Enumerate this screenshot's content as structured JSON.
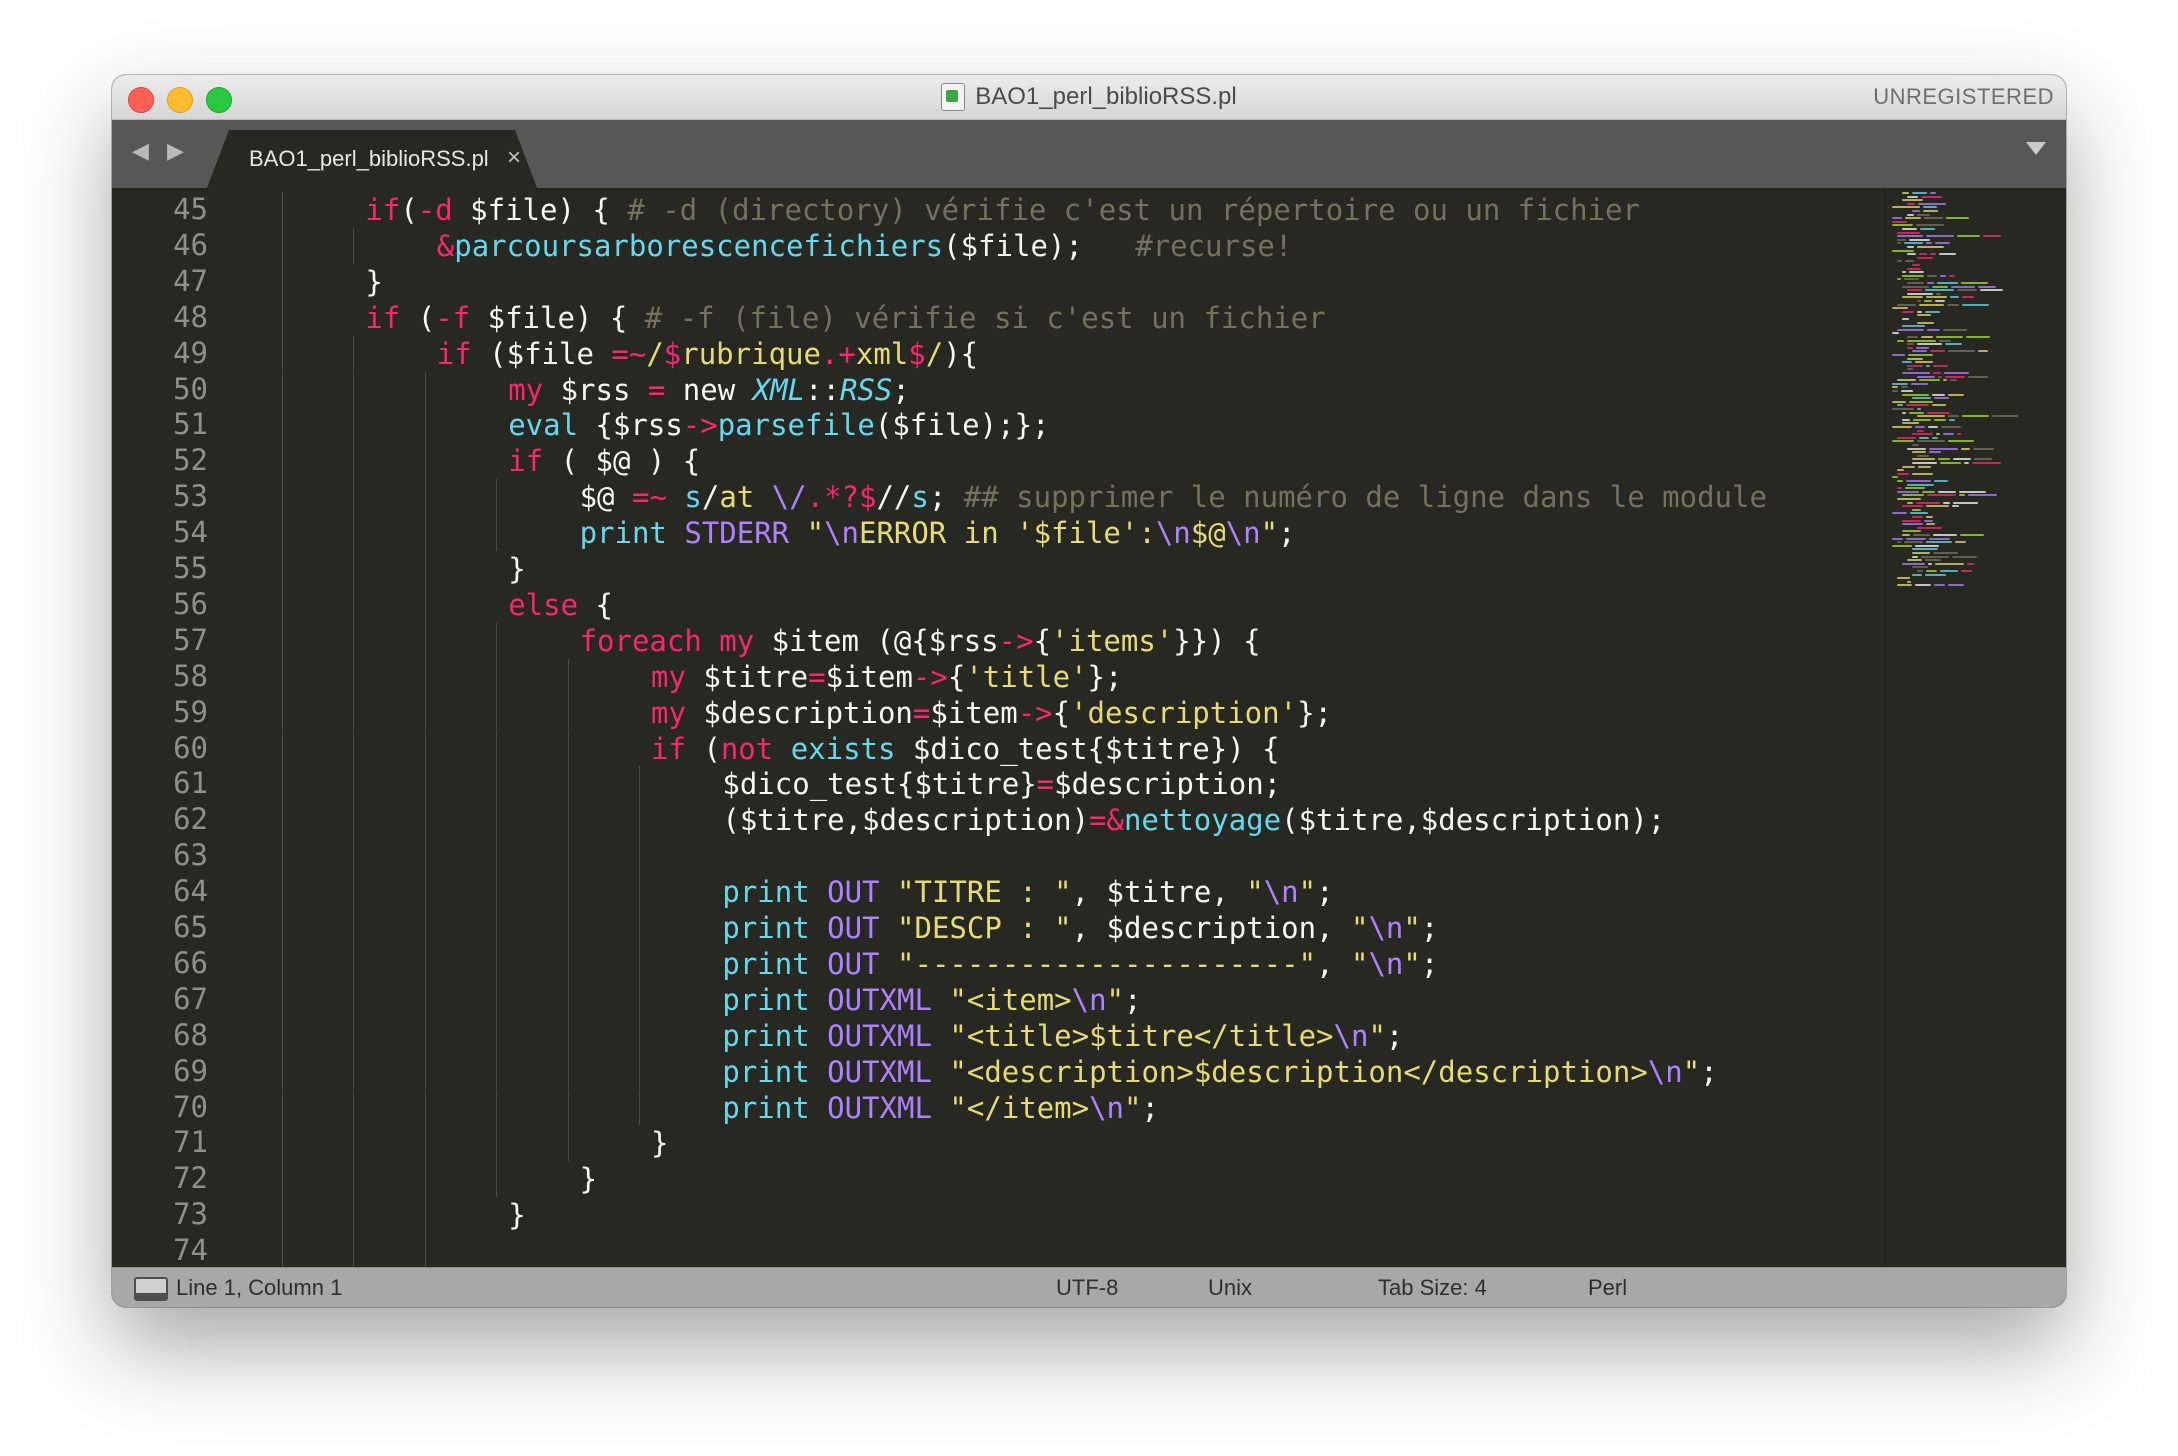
{
  "window": {
    "title": "BAO1_perl_biblioRSS.pl",
    "registration": "UNREGISTERED"
  },
  "tab": {
    "label": "BAO1_perl_biblioRSS.pl",
    "close": "×"
  },
  "nav": {
    "arrows": "◀ ▶"
  },
  "status": {
    "position": "Line 1, Column 1",
    "encoding": "UTF-8",
    "line_endings": "Unix",
    "tab_size": "Tab Size: 4",
    "syntax": "Perl"
  },
  "colors": {
    "keyword": "#f92672",
    "string": "#e6db74",
    "comment": "#75715e",
    "function": "#66d9ef",
    "constant": "#ae81ff",
    "entity": "#a6e22e",
    "background": "#272822",
    "foreground": "#f8f8f2"
  },
  "editor": {
    "lines": [
      {
        "num": "45",
        "indent": 2,
        "tokens": [
          [
            "k",
            "if"
          ],
          [
            "",
            "("
          ],
          [
            "o",
            "-d"
          ],
          [
            "",
            " $file) { "
          ],
          [
            "c",
            "# -d (directory) vérifie c'est un répertoire ou un fichier"
          ]
        ]
      },
      {
        "num": "46",
        "indent": 3,
        "tokens": [
          [
            "o",
            "&"
          ],
          [
            "f",
            "parcoursarborescencefichiers"
          ],
          [
            "",
            "($file);   "
          ],
          [
            "c",
            "#recurse!"
          ]
        ]
      },
      {
        "num": "47",
        "indent": 2,
        "tokens": [
          [
            "",
            "}"
          ]
        ]
      },
      {
        "num": "48",
        "indent": 2,
        "tokens": [
          [
            "k",
            "if"
          ],
          [
            "",
            " ("
          ],
          [
            "o",
            "-f"
          ],
          [
            "",
            " $file) { "
          ],
          [
            "c",
            "# -f (file) vérifie si c'est un fichier"
          ]
        ]
      },
      {
        "num": "49",
        "indent": 3,
        "tokens": [
          [
            "k",
            "if"
          ],
          [
            "",
            " ($file "
          ],
          [
            "o",
            "=~"
          ],
          [
            "s",
            "/"
          ],
          [
            "o",
            "$"
          ],
          [
            "s",
            "rubrique"
          ],
          [
            "o",
            ".+"
          ],
          [
            "s",
            "xml"
          ],
          [
            "o",
            "$"
          ],
          [
            "s",
            "/"
          ],
          [
            "",
            "){"
          ]
        ]
      },
      {
        "num": "50",
        "indent": 4,
        "tokens": [
          [
            "k",
            "my"
          ],
          [
            "",
            " $rss "
          ],
          [
            "o",
            "="
          ],
          [
            "",
            " new "
          ],
          [
            "i",
            "XML"
          ],
          [
            "",
            "::"
          ],
          [
            "i",
            "RSS"
          ],
          [
            "",
            ";"
          ]
        ]
      },
      {
        "num": "51",
        "indent": 4,
        "tokens": [
          [
            "f",
            "eval"
          ],
          [
            "",
            " {$rss"
          ],
          [
            "o",
            "->"
          ],
          [
            "f",
            "parsefile"
          ],
          [
            "",
            "($file);};"
          ]
        ]
      },
      {
        "num": "52",
        "indent": 4,
        "tokens": [
          [
            "k",
            "if"
          ],
          [
            "",
            " ( $@ ) {"
          ]
        ]
      },
      {
        "num": "53",
        "indent": 5,
        "tokens": [
          [
            "",
            "$@ "
          ],
          [
            "o",
            "=~"
          ],
          [
            "",
            " "
          ],
          [
            "f",
            "s"
          ],
          [
            "",
            "/"
          ],
          [
            "s",
            "at "
          ],
          [
            "n",
            "\\/"
          ],
          [
            "o",
            ".*?$"
          ],
          [
            "",
            "//"
          ],
          [
            "f",
            "s"
          ],
          [
            "",
            ";"
          ],
          [
            "",
            " "
          ],
          [
            "c",
            "## supprimer le numéro de ligne dans le module"
          ]
        ]
      },
      {
        "num": "54",
        "indent": 5,
        "tokens": [
          [
            "f",
            "print"
          ],
          [
            "",
            " "
          ],
          [
            "n",
            "STDERR"
          ],
          [
            "",
            " "
          ],
          [
            "s",
            "\""
          ],
          [
            "n",
            "\\n"
          ],
          [
            "s",
            "ERROR in '$file':"
          ],
          [
            "n",
            "\\n"
          ],
          [
            "s",
            "$@"
          ],
          [
            "n",
            "\\n"
          ],
          [
            "s",
            "\""
          ],
          [
            "",
            ";"
          ]
        ]
      },
      {
        "num": "55",
        "indent": 4,
        "tokens": [
          [
            "",
            "}"
          ]
        ]
      },
      {
        "num": "56",
        "indent": 4,
        "tokens": [
          [
            "k",
            "else"
          ],
          [
            "",
            " {"
          ]
        ]
      },
      {
        "num": "57",
        "indent": 5,
        "tokens": [
          [
            "k",
            "foreach"
          ],
          [
            "",
            " "
          ],
          [
            "k",
            "my"
          ],
          [
            "",
            " $item (@{$rss"
          ],
          [
            "o",
            "->"
          ],
          [
            "",
            "{"
          ],
          [
            "s",
            "'items'"
          ],
          [
            "",
            "}}) {"
          ]
        ]
      },
      {
        "num": "58",
        "indent": 6,
        "tokens": [
          [
            "k",
            "my"
          ],
          [
            "",
            " $titre"
          ],
          [
            "o",
            "="
          ],
          [
            "",
            "$item"
          ],
          [
            "o",
            "->"
          ],
          [
            "",
            "{"
          ],
          [
            "s",
            "'title'"
          ],
          [
            "",
            "};"
          ]
        ]
      },
      {
        "num": "59",
        "indent": 6,
        "tokens": [
          [
            "k",
            "my"
          ],
          [
            "",
            " $description"
          ],
          [
            "o",
            "="
          ],
          [
            "",
            "$item"
          ],
          [
            "o",
            "->"
          ],
          [
            "",
            "{"
          ],
          [
            "s",
            "'description'"
          ],
          [
            "",
            "};"
          ]
        ]
      },
      {
        "num": "60",
        "indent": 6,
        "tokens": [
          [
            "k",
            "if"
          ],
          [
            "",
            " ("
          ],
          [
            "k",
            "not"
          ],
          [
            "",
            " "
          ],
          [
            "f",
            "exists"
          ],
          [
            "",
            " $dico_test{$titre}) {"
          ]
        ]
      },
      {
        "num": "61",
        "indent": 7,
        "tokens": [
          [
            "",
            "$dico_test{$titre}"
          ],
          [
            "o",
            "="
          ],
          [
            "",
            "$description;"
          ]
        ]
      },
      {
        "num": "62",
        "indent": 7,
        "tokens": [
          [
            "",
            "($titre,$description)"
          ],
          [
            "o",
            "=&"
          ],
          [
            "f",
            "nettoyage"
          ],
          [
            "",
            "($titre,$description);"
          ]
        ]
      },
      {
        "num": "63",
        "indent": 7,
        "tokens": []
      },
      {
        "num": "64",
        "indent": 7,
        "tokens": [
          [
            "f",
            "print"
          ],
          [
            "",
            " "
          ],
          [
            "n",
            "OUT"
          ],
          [
            "",
            " "
          ],
          [
            "s",
            "\"TITRE : \""
          ],
          [
            "",
            ", $titre, "
          ],
          [
            "s",
            "\""
          ],
          [
            "n",
            "\\n"
          ],
          [
            "s",
            "\""
          ],
          [
            "",
            ";"
          ]
        ]
      },
      {
        "num": "65",
        "indent": 7,
        "tokens": [
          [
            "f",
            "print"
          ],
          [
            "",
            " "
          ],
          [
            "n",
            "OUT"
          ],
          [
            "",
            " "
          ],
          [
            "s",
            "\"DESCP : \""
          ],
          [
            "",
            ", $description, "
          ],
          [
            "s",
            "\""
          ],
          [
            "n",
            "\\n"
          ],
          [
            "s",
            "\""
          ],
          [
            "",
            ";"
          ]
        ]
      },
      {
        "num": "66",
        "indent": 7,
        "tokens": [
          [
            "f",
            "print"
          ],
          [
            "",
            " "
          ],
          [
            "n",
            "OUT"
          ],
          [
            "",
            " "
          ],
          [
            "s",
            "\"----------------------\""
          ],
          [
            "",
            ", "
          ],
          [
            "s",
            "\""
          ],
          [
            "n",
            "\\n"
          ],
          [
            "s",
            "\""
          ],
          [
            "",
            ";"
          ]
        ]
      },
      {
        "num": "67",
        "indent": 7,
        "tokens": [
          [
            "f",
            "print"
          ],
          [
            "",
            " "
          ],
          [
            "n",
            "OUTXML"
          ],
          [
            "",
            " "
          ],
          [
            "s",
            "\"<item>"
          ],
          [
            "n",
            "\\n"
          ],
          [
            "s",
            "\""
          ],
          [
            "",
            ";"
          ]
        ]
      },
      {
        "num": "68",
        "indent": 7,
        "tokens": [
          [
            "f",
            "print"
          ],
          [
            "",
            " "
          ],
          [
            "n",
            "OUTXML"
          ],
          [
            "",
            " "
          ],
          [
            "s",
            "\"<title>$titre</title>"
          ],
          [
            "n",
            "\\n"
          ],
          [
            "s",
            "\""
          ],
          [
            "",
            ";"
          ]
        ]
      },
      {
        "num": "69",
        "indent": 7,
        "tokens": [
          [
            "f",
            "print"
          ],
          [
            "",
            " "
          ],
          [
            "n",
            "OUTXML"
          ],
          [
            "",
            " "
          ],
          [
            "s",
            "\"<description>$description</description>"
          ],
          [
            "n",
            "\\n"
          ],
          [
            "s",
            "\""
          ],
          [
            "",
            ";"
          ]
        ]
      },
      {
        "num": "70",
        "indent": 7,
        "tokens": [
          [
            "f",
            "print"
          ],
          [
            "",
            " "
          ],
          [
            "n",
            "OUTXML"
          ],
          [
            "",
            " "
          ],
          [
            "s",
            "\"</item>"
          ],
          [
            "n",
            "\\n"
          ],
          [
            "s",
            "\""
          ],
          [
            "",
            ";"
          ]
        ]
      },
      {
        "num": "71",
        "indent": 6,
        "tokens": [
          [
            "",
            "}"
          ]
        ]
      },
      {
        "num": "72",
        "indent": 5,
        "tokens": [
          [
            "",
            "}"
          ]
        ]
      },
      {
        "num": "73",
        "indent": 4,
        "tokens": [
          [
            "",
            "}"
          ]
        ]
      },
      {
        "num": "74",
        "indent": 4,
        "tokens": []
      }
    ]
  }
}
